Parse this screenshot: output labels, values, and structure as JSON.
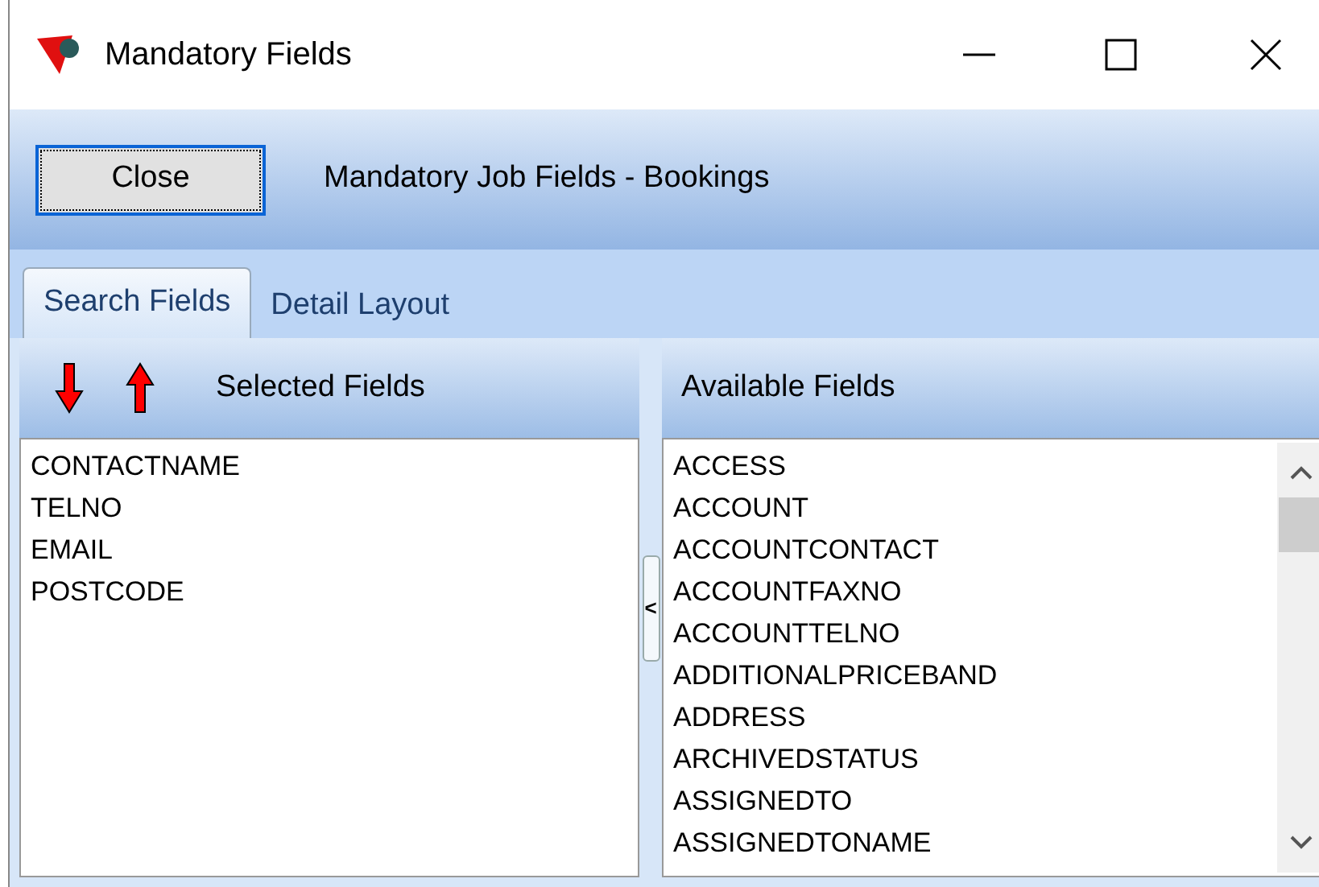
{
  "window": {
    "title": "Mandatory Fields"
  },
  "toolbar": {
    "close_button": "Close",
    "caption": "Mandatory Job Fields - Bookings"
  },
  "tabs": [
    {
      "label": "Search Fields",
      "selected": true
    },
    {
      "label": "Detail Layout",
      "selected": false
    }
  ],
  "selected_fields": {
    "title": "Selected Fields",
    "items": [
      "CONTACTNAME",
      "TELNO",
      "EMAIL",
      "POSTCODE"
    ]
  },
  "splitter": {
    "glyph": "<"
  },
  "available_fields": {
    "title": "Available Fields",
    "items": [
      "ACCESS",
      "ACCOUNT",
      "ACCOUNTCONTACT",
      "ACCOUNTFAXNO",
      "ACCOUNTTELNO",
      "ADDITIONALPRICEBAND",
      "ADDRESS",
      "ARCHIVEDSTATUS",
      "ASSIGNEDTO",
      "ASSIGNEDTONAME"
    ]
  }
}
